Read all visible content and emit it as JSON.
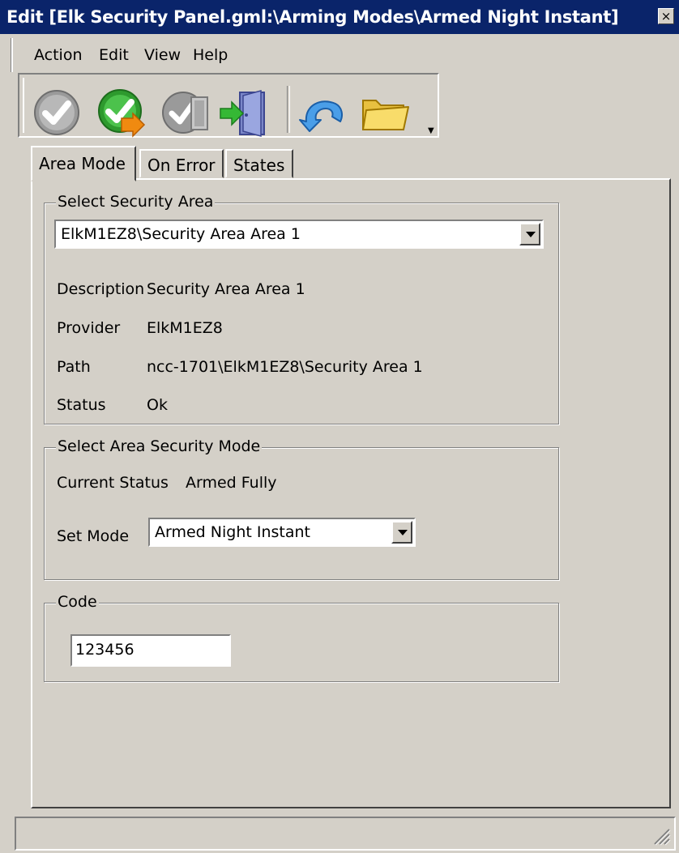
{
  "window": {
    "title": "Edit [Elk Security Panel.gml:\\Arming Modes\\Armed Night Instant]",
    "close_glyph": "×"
  },
  "menu": [
    "Action",
    "Edit",
    "View",
    "Help"
  ],
  "toolbar": {
    "icons": [
      "check-icon",
      "check-go-icon",
      "check-door-icon",
      "exit-door-icon",
      "undo-icon",
      "folder-icon"
    ],
    "dropdown_glyph": "▼"
  },
  "tabs": [
    "Area Mode",
    "On Error",
    "States"
  ],
  "security_area": {
    "legend": "Select Security Area",
    "selected": "ElkM1EZ8\\Security Area Area 1",
    "fields": [
      {
        "label": "Description",
        "value": "Security Area Area 1"
      },
      {
        "label": "Provider",
        "value": "ElkM1EZ8"
      },
      {
        "label": "Path",
        "value": "ncc-1701\\ElkM1EZ8\\Security Area 1"
      },
      {
        "label": "Status",
        "value": "Ok"
      }
    ]
  },
  "security_mode": {
    "legend": "Select Area Security Mode",
    "current_status_label": "Current Status",
    "current_status_value": "Armed Fully",
    "set_mode_label": "Set Mode",
    "set_mode_value": "Armed Night Instant"
  },
  "code": {
    "legend": "Code",
    "value": "123456"
  },
  "colors": {
    "titlebar": "#0a246a",
    "face": "#d4d0c8"
  }
}
